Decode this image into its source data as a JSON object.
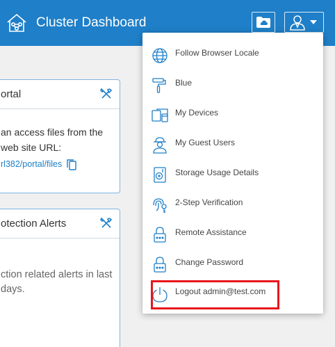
{
  "header": {
    "title": "Cluster Dashboard",
    "logo_icon": "house-network-icon",
    "folder_button_icon": "folder-cloud-icon",
    "user_button_icon": "user-icon"
  },
  "panels": {
    "portal": {
      "title_fragment": "ortal",
      "text_line1": "an access files from the",
      "text_line2": "web site URL:",
      "link_fragment": "rl382/portal/files"
    },
    "alerts": {
      "title_fragment": "otection Alerts",
      "text_line1": "ction related alerts in last",
      "text_line2": "days."
    }
  },
  "menu": {
    "items": [
      {
        "label": "Follow Browser Locale",
        "icon": "globe-icon"
      },
      {
        "label": "Blue",
        "icon": "paint-roller-icon"
      },
      {
        "label": "My Devices",
        "icon": "devices-icon"
      },
      {
        "label": "My Guest Users",
        "icon": "guest-user-icon"
      },
      {
        "label": "Storage Usage Details",
        "icon": "storage-disk-icon"
      },
      {
        "label": "2-Step Verification",
        "icon": "fingerprint-key-icon"
      },
      {
        "label": "Remote Assistance",
        "icon": "remote-lock-icon"
      },
      {
        "label": "Change Password",
        "icon": "password-lock-icon"
      },
      {
        "label": "Logout admin@test.com",
        "icon": "power-icon"
      }
    ]
  },
  "colors": {
    "header_bg": "#1f7fc8",
    "accent": "#1f7fc8",
    "highlight": "#e8161b"
  }
}
